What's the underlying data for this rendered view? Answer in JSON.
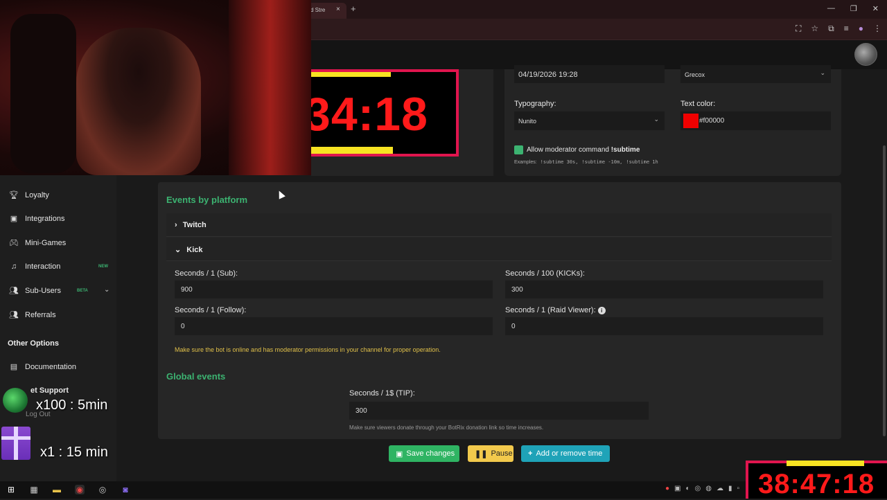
{
  "browser": {
    "tab_title": "d Stre",
    "tab_close": "×",
    "new_tab": "+",
    "window_controls": [
      "—",
      "❐",
      "✕"
    ]
  },
  "timer_preview": {
    "text": "34:18",
    "text_color": "#ff1a1a",
    "border_color": "#e0154e",
    "bar_color": "#f7e322"
  },
  "settings": {
    "end_date_value": "04/19/2026 19:28",
    "style_select_value": "Grecox",
    "typography_label": "Typography:",
    "typography_value": "Nunito",
    "text_color_label": "Text color:",
    "text_color_value": "#f00000",
    "text_color_swatch": "#f00000",
    "moderator_checkbox_label": "Allow moderator command",
    "moderator_command": "!subtime",
    "moderator_checked": true,
    "examples_label": "Examples:",
    "examples": [
      "!subtime 30s,",
      "!subtime -10m,",
      "!subtime 1h"
    ]
  },
  "sidebar": {
    "items": [
      {
        "label": "Loyalty",
        "icon": "trophy-icon"
      },
      {
        "label": "Integrations",
        "icon": "plug-icon"
      },
      {
        "label": "Mini-Games",
        "icon": "gamepad-icon"
      },
      {
        "label": "Interaction",
        "icon": "music-icon",
        "badge": "NEW"
      },
      {
        "label": "Sub-Users",
        "icon": "users-icon",
        "badge": "BETA"
      },
      {
        "label": "Referrals",
        "icon": "referral-icon"
      }
    ],
    "other_options_title": "Other Options",
    "other_items": [
      {
        "label": "Documentation",
        "icon": "document-icon"
      },
      {
        "label": "et Support",
        "icon": "support-icon"
      },
      {
        "label": "Log Out",
        "icon": "logout-icon"
      }
    ]
  },
  "events": {
    "title": "Events by platform",
    "twitch_label": "Twitch",
    "kick_label": "Kick",
    "sub_label": "Seconds / 1 (Sub):",
    "sub_value": "900",
    "kicks_label": "Seconds / 100 (KICKs):",
    "kicks_value": "300",
    "follow_label": "Seconds / 1 (Follow):",
    "follow_value": "0",
    "raid_label": "Seconds / 1 (Raid Viewer):",
    "raid_value": "0",
    "warning": "Make sure the bot is online and has moderator permissions in your channel for proper operation."
  },
  "global_events": {
    "title": "Global events",
    "tip_label": "Seconds / 1$ (TIP):",
    "tip_value": "300",
    "tip_hint": "Make sure viewers donate through your BotRix donation link so time increases."
  },
  "buttons": {
    "save": "Save changes",
    "pause": "Pause",
    "add_remove": "Add or remove time"
  },
  "overlays": {
    "sub_rate": "x100 : 5min",
    "gift_rate": "x1 : 15 min",
    "big_timer": "38:47:18"
  }
}
